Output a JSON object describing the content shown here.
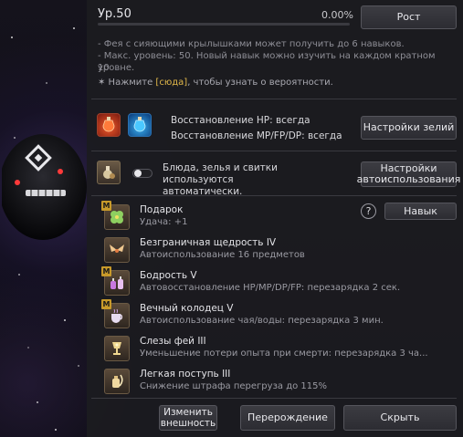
{
  "header": {
    "level_label": "Ур.50",
    "percent": "0.00%",
    "progress": 0.0,
    "grow_button": "Рост"
  },
  "info_lines": [
    "- Фея с сияющими крылышками может получить до 6 навыков.",
    "- Макс. уровень: 50. Новый навык можно изучить на каждом кратном 10",
    "уровне."
  ],
  "hint": {
    "prefix": "✶ Нажмите ",
    "link": "[сюда]",
    "suffix": ", чтобы узнать о вероятности."
  },
  "potions": {
    "hp_text": "Восстановление HP: всегда",
    "mp_text": "Восстановление MP/FP/DP: всегда",
    "settings_button": "Настройки зелий",
    "hp_icon": "red-potion-icon",
    "mp_icon": "blue-potion-icon"
  },
  "auto_use": {
    "text_line1": "Блюда, зелья и свитки используются",
    "text_line2": "автоматически.",
    "settings_button_line1": "Настройки",
    "settings_button_line2": "автоиспользования",
    "toggle_on": false
  },
  "skill_button": "Навык",
  "skills": [
    {
      "name": "Подарок",
      "desc": "Удача: +1",
      "badge": "M",
      "icon": "clover-icon"
    },
    {
      "name": "Безграничная щедрость IV",
      "desc": "Автоиспользование 16 предметов",
      "badge": "",
      "icon": "wings-icon"
    },
    {
      "name": "Бодрость V",
      "desc": "Автовосстановление HP/MP/DP/FP: перезарядка 2 сек.",
      "badge": "M",
      "icon": "potion-bottles-icon"
    },
    {
      "name": "Вечный колодец V",
      "desc": "Автоиспользование чая/воды: перезарядка 3 мин.",
      "badge": "M",
      "icon": "tea-cup-icon"
    },
    {
      "name": "Слезы фей III",
      "desc": "Уменьшение потери опыта при смерти: перезарядка 3 ча...",
      "badge": "",
      "icon": "chalice-icon"
    },
    {
      "name": "Легкая поступь III",
      "desc": "Снижение штрафа перегруза до 115%",
      "badge": "",
      "icon": "feather-bottle-icon"
    }
  ],
  "footer": {
    "change_look_line1": "Изменить",
    "change_look_line2": "внешность",
    "rebirth": "Перерождение",
    "hide": "Скрыть"
  }
}
